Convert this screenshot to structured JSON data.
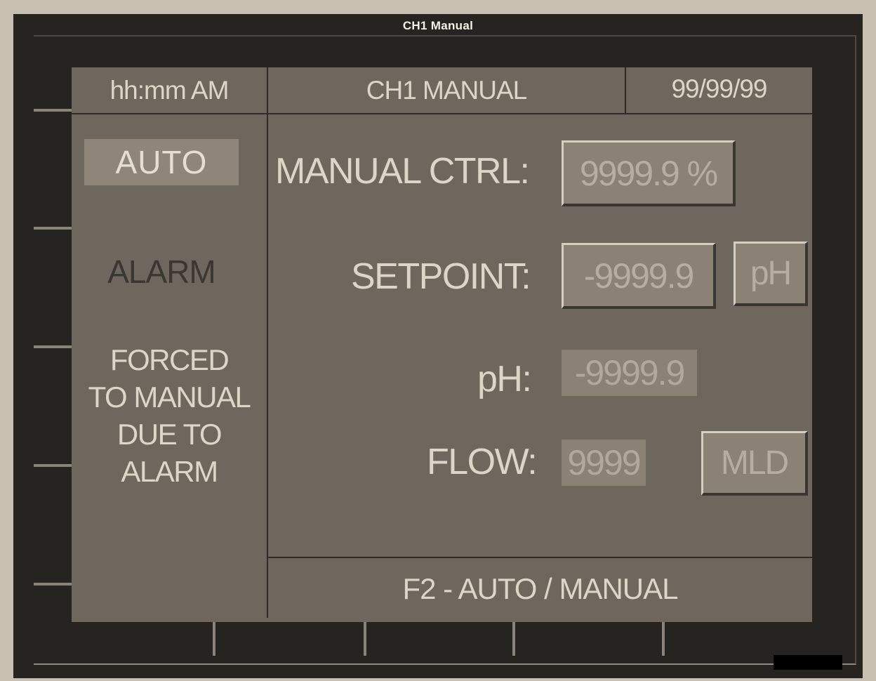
{
  "window": {
    "title": "CH1 Manual"
  },
  "header": {
    "time": "hh:mm AM",
    "screen_title": "CH1 MANUAL",
    "date": "99/99/99"
  },
  "status": {
    "mode": "AUTO",
    "alarm": "ALARM",
    "forced_message_lines": [
      "FORCED",
      "TO MANUAL",
      "DUE TO",
      "ALARM"
    ]
  },
  "fields": {
    "manual_ctrl": {
      "label": "MANUAL CTRL:",
      "value": "9999.9 %"
    },
    "setpoint": {
      "label": "SETPOINT:",
      "value": "-9999.9",
      "unit": "pH"
    },
    "ph": {
      "label": "pH:",
      "value": "-9999.9"
    },
    "flow": {
      "label": "FLOW:",
      "value": "9999",
      "unit": "MLD"
    }
  },
  "footer": {
    "function_key": "F2 - AUTO / MANUAL"
  },
  "colors": {
    "screen_bg": "#6f675e",
    "bezel": "#262421",
    "text": "#ddd5c8",
    "field_bg": "#8b8174",
    "alarm_text": "#3a3632"
  }
}
